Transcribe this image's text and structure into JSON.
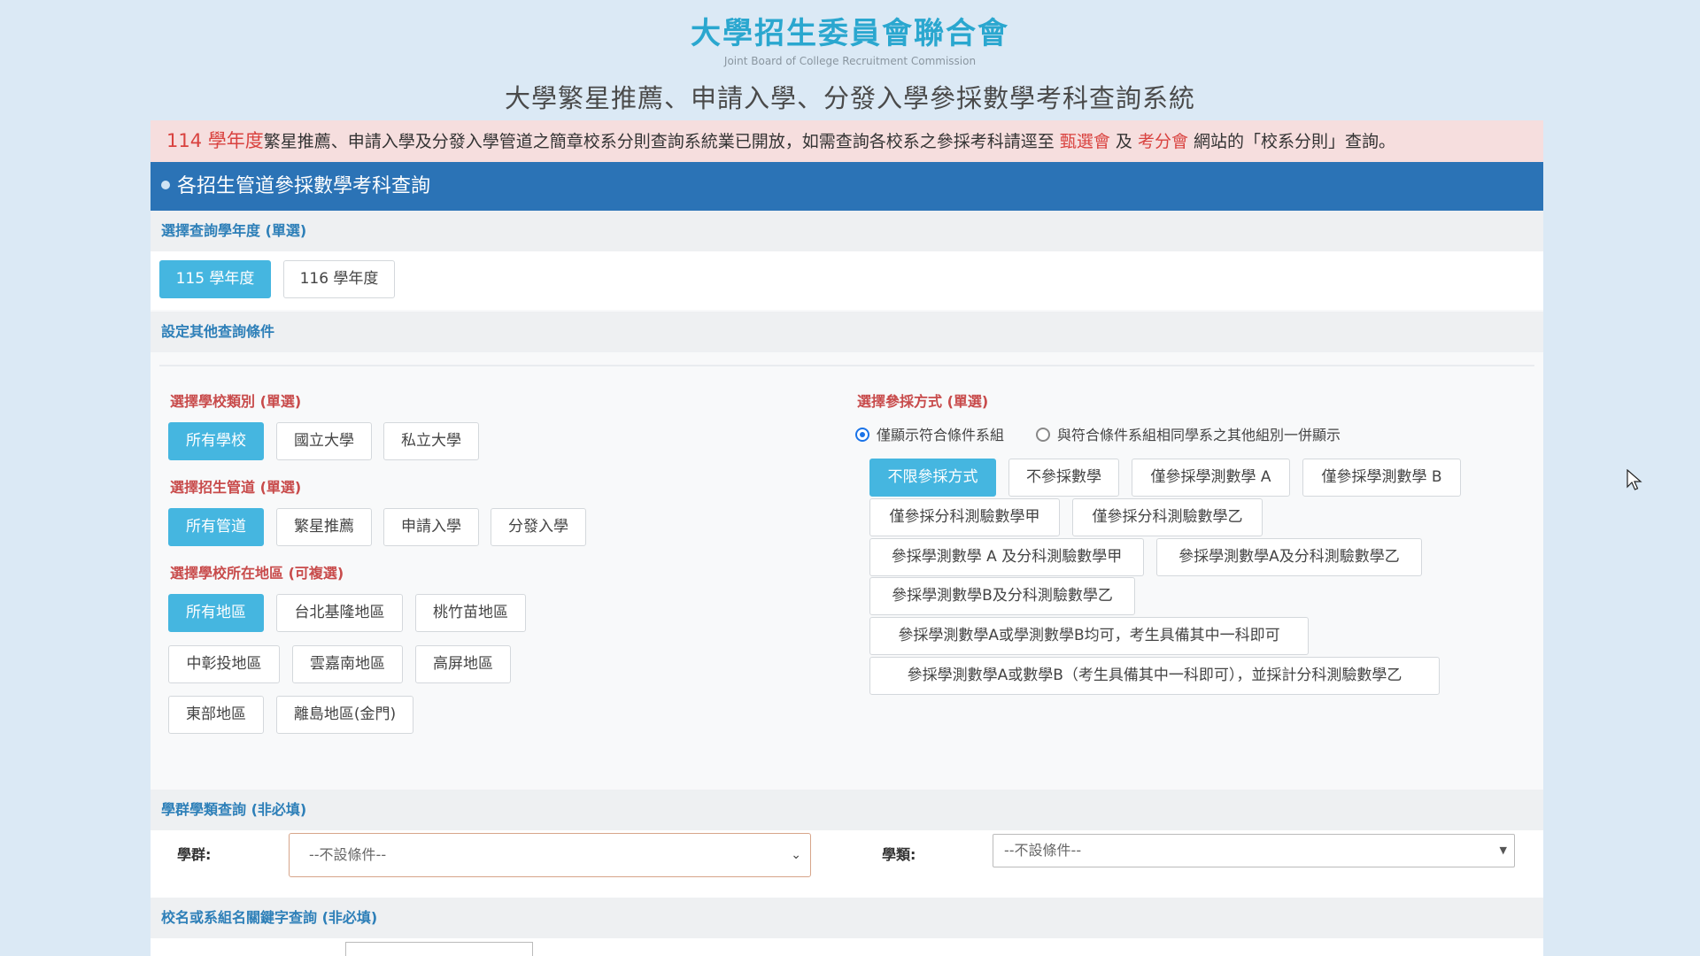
{
  "header": {
    "org_title": "大學招生委員會聯合會",
    "org_subtitle": "Joint Board of College Recruitment Commission",
    "system_title": "大學繁星推薦、申請入學、分發入學參採數學考科查詢系統"
  },
  "notice": {
    "year": "114 學年度",
    "text1": "繁星推薦、申請入學及分發入學管道之簡章校系分則查詢系統業已開放，如需查詢各校系之參採考科請逕至",
    "link1": "甄選會",
    "and": "及",
    "link2": "考分會",
    "text2": "網站的「校系分則」查詢。"
  },
  "main_bar": {
    "title": "各招生管道參採數學考科查詢"
  },
  "year_section": {
    "heading": "選擇查詢學年度 (單選)",
    "options": [
      "115 學年度",
      "116 學年度"
    ],
    "selected": "115 學年度"
  },
  "other_conditions": {
    "heading": "設定其他查詢條件"
  },
  "school_type": {
    "label": "選擇學校類別 (單選)",
    "options": [
      "所有學校",
      "國立大學",
      "私立大學"
    ],
    "selected": "所有學校"
  },
  "channel": {
    "label": "選擇招生管道 (單選)",
    "options": [
      "所有管道",
      "繁星推薦",
      "申請入學",
      "分發入學"
    ],
    "selected": "所有管道"
  },
  "region": {
    "label": "選擇學校所在地區 (可複選)",
    "options": [
      "所有地區",
      "台北基隆地區",
      "桃竹苗地區",
      "中彰投地區",
      "雲嘉南地區",
      "高屏地區",
      "東部地區",
      "離島地區(金門)"
    ],
    "selected": "所有地區"
  },
  "adoption": {
    "label": "選擇參採方式 (單選)",
    "radio1": "僅顯示符合條件系組",
    "radio2": "與符合條件系組相同學系之其他組別一併顯示",
    "radio_selected": "僅顯示符合條件系組",
    "options": [
      "不限參採方式",
      "不參採數學",
      "僅參採學測數學 A",
      "僅參採學測數學 B",
      "僅參採分科測驗數學甲",
      "僅參採分科測驗數學乙",
      "參採學測數學 A 及分科測驗數學甲",
      "參採學測數學A及分科測驗數學乙",
      "參採學測數學B及分科測驗數學乙",
      "參採學測數學A或學測數學B均可，考生具備其中一科即可",
      "參採學測數學A或數學B（考生具備其中一科即可），並採計分科測驗數學乙"
    ],
    "selected": "不限參採方式"
  },
  "discipline": {
    "heading": "學群學類查詢 (非必填)",
    "group_label": "學群:",
    "group_value": "--不設條件--",
    "category_label": "學類:",
    "category_value": "--不設條件--"
  },
  "keyword": {
    "heading": "校名或系組名關鍵字查詢 (非必填)"
  },
  "colors": {
    "accent": "#45b6e0",
    "bar": "#2b73b6",
    "title": "#2aa7cf",
    "label_red": "#c84b4b",
    "notice_red": "#d9423f"
  }
}
